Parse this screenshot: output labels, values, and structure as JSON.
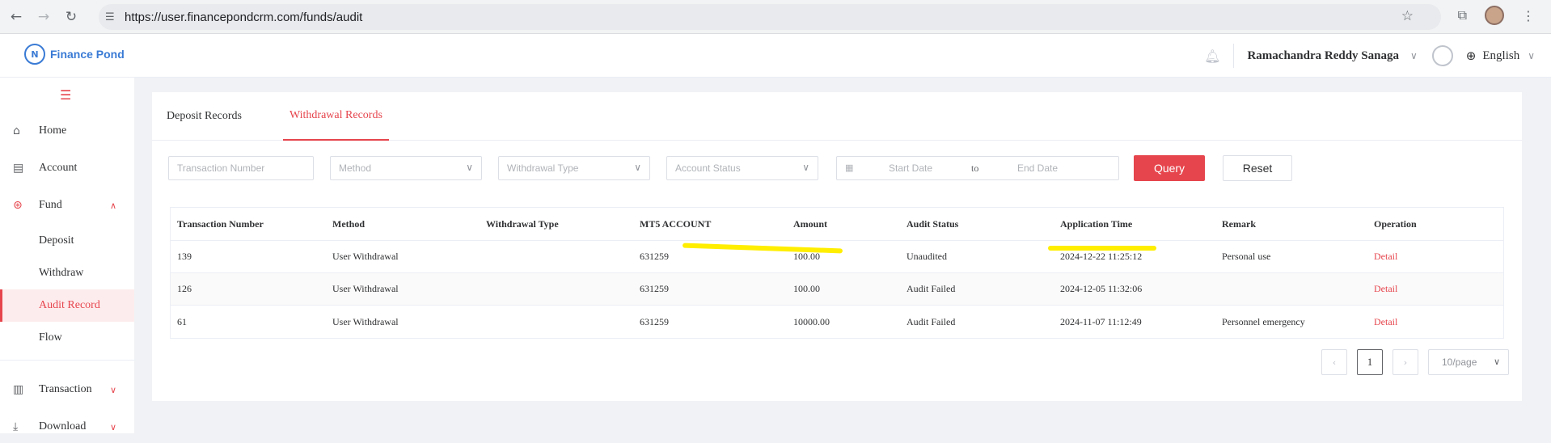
{
  "browser": {
    "url": "https://user.financepondcrm.com/funds/audit"
  },
  "header": {
    "logo_text": "Finance Pond",
    "user_name": "Ramachandra Reddy Sanaga",
    "language": "English"
  },
  "sidebar": {
    "items": [
      {
        "label": "Home"
      },
      {
        "label": "Account"
      },
      {
        "label": "Fund"
      },
      {
        "label": "Transaction"
      },
      {
        "label": "Download"
      }
    ],
    "fund_sub": [
      {
        "label": "Deposit"
      },
      {
        "label": "Withdraw"
      },
      {
        "label": "Audit Record"
      },
      {
        "label": "Flow"
      }
    ]
  },
  "tabs": [
    {
      "label": "Deposit Records"
    },
    {
      "label": "Withdrawal Records"
    }
  ],
  "filters": {
    "transaction_number": "Transaction Number",
    "method": "Method",
    "withdrawal_type": "Withdrawal Type",
    "account_status": "Account Status",
    "start_date": "Start Date",
    "to": "to",
    "end_date": "End Date",
    "query": "Query",
    "reset": "Reset"
  },
  "table": {
    "headers": [
      "Transaction Number",
      "Method",
      "Withdrawal Type",
      "MT5 ACCOUNT",
      "Amount",
      "Audit Status",
      "Application Time",
      "Remark",
      "Operation"
    ],
    "rows": [
      [
        "139",
        "User Withdrawal",
        "",
        "631259",
        "100.00",
        "Unaudited",
        "2024-12-22 11:25:12",
        "Personal use",
        "Detail"
      ],
      [
        "126",
        "User Withdrawal",
        "",
        "631259",
        "100.00",
        "Audit Failed",
        "2024-12-05 11:32:06",
        "",
        "Detail"
      ],
      [
        "61",
        "User Withdrawal",
        "",
        "631259",
        "10000.00",
        "Audit Failed",
        "2024-11-07 11:12:49",
        "Personnel emergency",
        "Detail"
      ]
    ]
  },
  "pagination": {
    "current_page": "1",
    "page_size": "10/page"
  },
  "colors": {
    "accent": "#e6454d",
    "highlight": "#ffee00"
  }
}
